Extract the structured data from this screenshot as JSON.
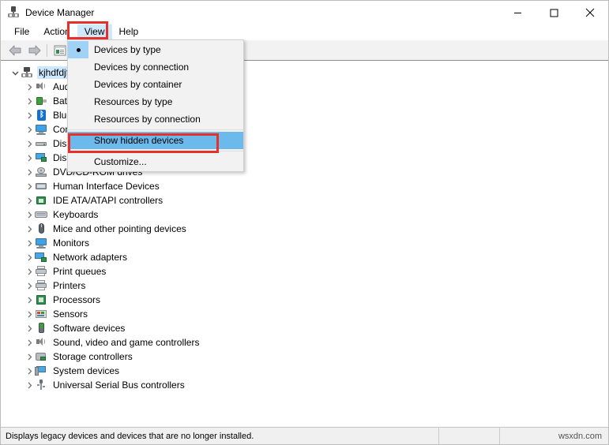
{
  "window": {
    "title": "Device Manager",
    "icon": "device-manager-icon",
    "controls": {
      "minimize": "minimize-icon",
      "maximize": "maximize-icon",
      "close": "close-icon"
    }
  },
  "menubar": {
    "items": [
      {
        "label": "File",
        "active": false
      },
      {
        "label": "Action",
        "active": false
      },
      {
        "label": "View",
        "active": true
      },
      {
        "label": "Help",
        "active": false
      }
    ]
  },
  "toolbar": {
    "buttons": [
      {
        "name": "back-button",
        "icon": "back-arrow-icon"
      },
      {
        "name": "forward-button",
        "icon": "forward-arrow-icon"
      },
      {
        "name": "properties-button",
        "icon": "properties-icon"
      }
    ]
  },
  "view_menu": {
    "items": [
      {
        "label": "Devices by type",
        "checked": true,
        "highlight": false,
        "separator_after": false
      },
      {
        "label": "Devices by connection",
        "checked": false,
        "highlight": false,
        "separator_after": false
      },
      {
        "label": "Devices by container",
        "checked": false,
        "highlight": false,
        "separator_after": false
      },
      {
        "label": "Resources by type",
        "checked": false,
        "highlight": false,
        "separator_after": false
      },
      {
        "label": "Resources by connection",
        "checked": false,
        "highlight": false,
        "separator_after": true
      },
      {
        "label": "Show hidden devices",
        "checked": false,
        "highlight": true,
        "separator_after": true
      },
      {
        "label": "Customize...",
        "checked": false,
        "highlight": false,
        "separator_after": false
      }
    ]
  },
  "annotations": {
    "highlight_color": "#e8302a",
    "view_menu_box": "red-box-view-menu",
    "show_hidden_devices_box": "red-box-show-hidden-devices"
  },
  "tree": {
    "root": {
      "label": "kjhdfdjf",
      "icon": "computer-icon",
      "expanded": true,
      "selected": true
    },
    "children": [
      {
        "label": "Audio inputs and outputs",
        "icon": "speaker-icon"
      },
      {
        "label": "Batteries",
        "icon": "battery-icon"
      },
      {
        "label": "Bluetooth",
        "icon": "bluetooth-icon"
      },
      {
        "label": "Computer",
        "icon": "monitor-icon"
      },
      {
        "label": "Disk drives",
        "icon": "disk-drive-icon"
      },
      {
        "label": "Display adapters",
        "icon": "display-adapter-icon"
      },
      {
        "label": "DVD/CD-ROM drives",
        "icon": "dvd-drive-icon"
      },
      {
        "label": "Human Interface Devices",
        "icon": "hid-icon"
      },
      {
        "label": "IDE ATA/ATAPI controllers",
        "icon": "ide-controller-icon"
      },
      {
        "label": "Keyboards",
        "icon": "keyboard-icon"
      },
      {
        "label": "Mice and other pointing devices",
        "icon": "mouse-icon"
      },
      {
        "label": "Monitors",
        "icon": "monitor-icon"
      },
      {
        "label": "Network adapters",
        "icon": "network-adapter-icon"
      },
      {
        "label": "Print queues",
        "icon": "printer-icon"
      },
      {
        "label": "Printers",
        "icon": "printer-icon"
      },
      {
        "label": "Processors",
        "icon": "processor-icon"
      },
      {
        "label": "Sensors",
        "icon": "sensor-icon"
      },
      {
        "label": "Software devices",
        "icon": "software-device-icon"
      },
      {
        "label": "Sound, video and game controllers",
        "icon": "speaker-icon"
      },
      {
        "label": "Storage controllers",
        "icon": "storage-controller-icon"
      },
      {
        "label": "System devices",
        "icon": "system-device-icon"
      },
      {
        "label": "Universal Serial Bus controllers",
        "icon": "usb-icon"
      }
    ]
  },
  "statusbar": {
    "message": "Displays legacy devices and devices that are no longer installed.",
    "middle": "",
    "watermark": "wsxdn.com"
  }
}
